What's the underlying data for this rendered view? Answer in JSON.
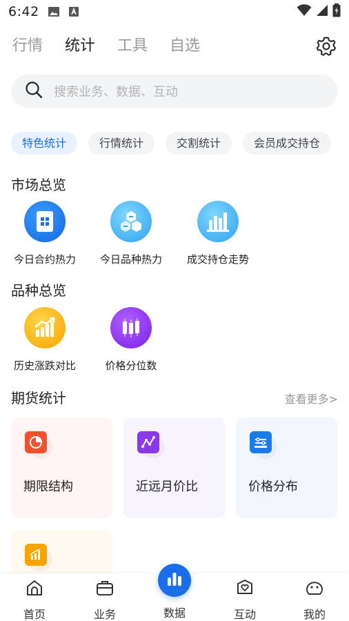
{
  "status_bar": {
    "time": "6:42"
  },
  "top_tabs": [
    {
      "label": "行情"
    },
    {
      "label": "统计"
    },
    {
      "label": "工具"
    },
    {
      "label": "自选"
    }
  ],
  "search": {
    "placeholder": "搜索业务、数据、互动"
  },
  "chips": [
    {
      "label": "特色统计"
    },
    {
      "label": "行情统计"
    },
    {
      "label": "交割统计"
    },
    {
      "label": "会员成交持仓"
    }
  ],
  "market_overview": {
    "title": "市场总览",
    "items": [
      {
        "label": "今日合约热力",
        "icon": "contract-heat-icon"
      },
      {
        "label": "今日品种热力",
        "icon": "variety-heat-icon"
      },
      {
        "label": "成交持仓走势",
        "icon": "volume-trend-icon"
      }
    ]
  },
  "variety_overview": {
    "title": "品种总览",
    "items": [
      {
        "label": "历史涨跌对比",
        "icon": "history-compare-icon"
      },
      {
        "label": "价格分位数",
        "icon": "price-percentile-icon"
      }
    ]
  },
  "futures_stats": {
    "title": "期货统计",
    "more": "查看更多>",
    "cards": [
      {
        "label": "期限结构",
        "icon": "term-structure-icon"
      },
      {
        "label": "近远月价比",
        "icon": "month-ratio-icon"
      },
      {
        "label": "价格分布",
        "icon": "price-distribution-icon"
      },
      {
        "label": "",
        "icon": "bar-chart-icon"
      }
    ]
  },
  "bottom_nav": [
    {
      "label": "首页"
    },
    {
      "label": "业务"
    },
    {
      "label": "数据"
    },
    {
      "label": "互动"
    },
    {
      "label": "我的"
    }
  ],
  "colors": {
    "accent": "#1a6fe8",
    "chip_active_bg": "#e9f1fd"
  }
}
